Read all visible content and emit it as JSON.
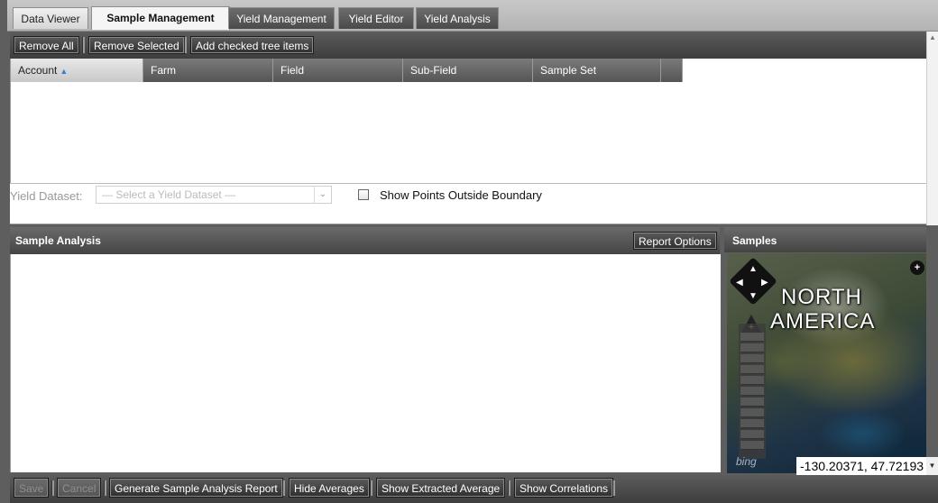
{
  "tabs": [
    {
      "label": "Data Viewer"
    },
    {
      "label": "Sample Management"
    },
    {
      "label": "Yield Management"
    },
    {
      "label": "Yield Editor"
    },
    {
      "label": "Yield Analysis"
    }
  ],
  "toolbar": {
    "remove_all": "Remove All",
    "remove_selected": "Remove Selected",
    "add_checked": "Add checked tree items"
  },
  "grid": {
    "columns": [
      "Account",
      "Farm",
      "Field",
      "Sub-Field",
      "Sample Set"
    ],
    "sorted_column": "Account",
    "sort_direction": "ascending"
  },
  "dataset": {
    "label": "Yield Dataset:",
    "placeholder": "— Select a Yield Dataset —",
    "checkbox_label": "Show Points Outside Boundary",
    "checked": false
  },
  "sample_analysis": {
    "title": "Sample Analysis",
    "report_options": "Report Options"
  },
  "samples": {
    "title": "Samples",
    "map_label_line1": "NORTH",
    "map_label_line2": "AMERICA",
    "coordinates": "-130.20371, 47.72193",
    "attribution": "bing"
  },
  "bottom": {
    "save": "Save",
    "cancel": "Cancel",
    "generate": "Generate Sample Analysis Report",
    "hide_averages": "Hide Averages",
    "show_extracted": "Show Extracted Average",
    "show_correlations": "Show Correlations"
  },
  "colors": {
    "toolbar": "#4a4a4a",
    "active_tab": "#f5f5f5",
    "header_sorted": "#d8d8d8",
    "sort_arrow": "#3a7fd0"
  }
}
